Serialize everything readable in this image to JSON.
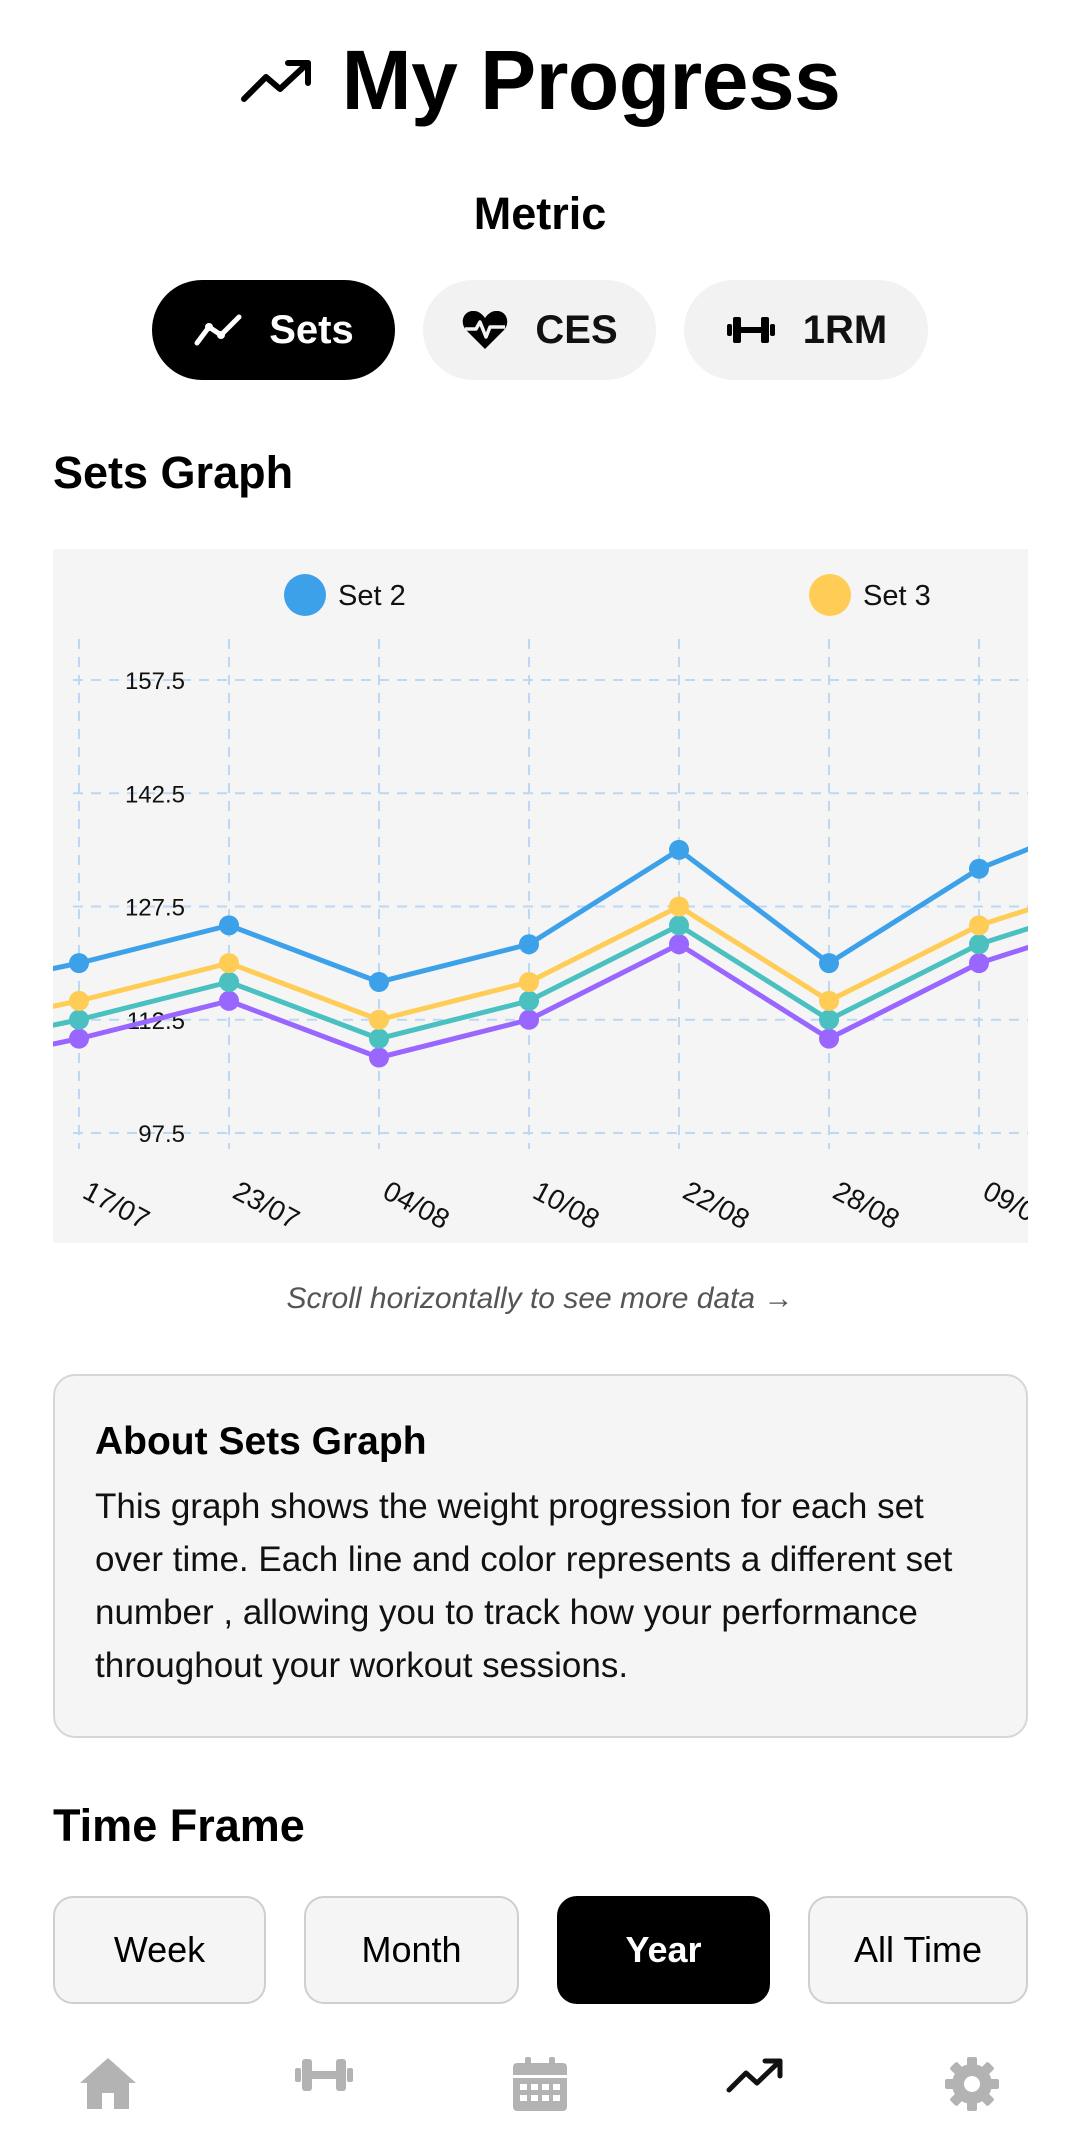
{
  "header": {
    "title": "My Progress",
    "icon": "trending-up-icon"
  },
  "metric": {
    "label": "Metric",
    "options": [
      {
        "label": "Sets",
        "icon": "line-chart-icon",
        "active": true
      },
      {
        "label": "CES",
        "icon": "heart-pulse-icon",
        "active": false
      },
      {
        "label": "1RM",
        "icon": "dumbbell-icon",
        "active": false
      }
    ]
  },
  "sets_graph": {
    "title": "Sets Graph",
    "scroll_hint": "Scroll horizontally to see more data →"
  },
  "chart_data": {
    "type": "line",
    "categories": [
      "17/07",
      "23/07",
      "04/08",
      "10/08",
      "22/08",
      "28/08",
      "09/0"
    ],
    "y_ticks": [
      "157.5",
      "142.5",
      "127.5",
      "112.5",
      "97.5"
    ],
    "ylim": [
      97.5,
      157.5
    ],
    "grid": true,
    "legend": [
      "Set 2",
      "Set 3"
    ],
    "series": [
      {
        "name": "Set 2",
        "color": "#3da1ea",
        "values": [
          120,
          125,
          117.5,
          122.5,
          135,
          120,
          132.5
        ]
      },
      {
        "name": "",
        "color": "#f07a9a",
        "values": [
          120,
          125,
          117.5,
          122.5,
          135,
          120,
          132.5
        ]
      },
      {
        "name": "Set 3",
        "color": "#ffcd56",
        "values": [
          115,
          120,
          112.5,
          117.5,
          127.5,
          115,
          125
        ]
      },
      {
        "name": "",
        "color": "#4bc0c0",
        "values": [
          112.5,
          117.5,
          110,
          115,
          125,
          112.5,
          122.5
        ]
      },
      {
        "name": "",
        "color": "#9966ff",
        "values": [
          110,
          115,
          107.5,
          112.5,
          122.5,
          110,
          120
        ]
      }
    ]
  },
  "about": {
    "title": "About Sets Graph",
    "body": "This graph shows the weight progression for each set over time. Each line and color represents a different set number , allowing you to track how your performance throughout your workout sessions."
  },
  "time_frame": {
    "title": "Time Frame",
    "options": [
      {
        "label": "Week",
        "active": false
      },
      {
        "label": "Month",
        "active": false
      },
      {
        "label": "Year",
        "active": true
      },
      {
        "label": "All Time",
        "active": false
      }
    ]
  },
  "nav": {
    "items": [
      {
        "icon": "home-icon",
        "active": false
      },
      {
        "icon": "dumbbell-icon",
        "active": false
      },
      {
        "icon": "calendar-icon",
        "active": false
      },
      {
        "icon": "trending-up-icon",
        "active": true
      },
      {
        "icon": "gear-icon",
        "active": false
      }
    ],
    "active_color": "#111111",
    "inactive_color": "#b3b3b3"
  }
}
